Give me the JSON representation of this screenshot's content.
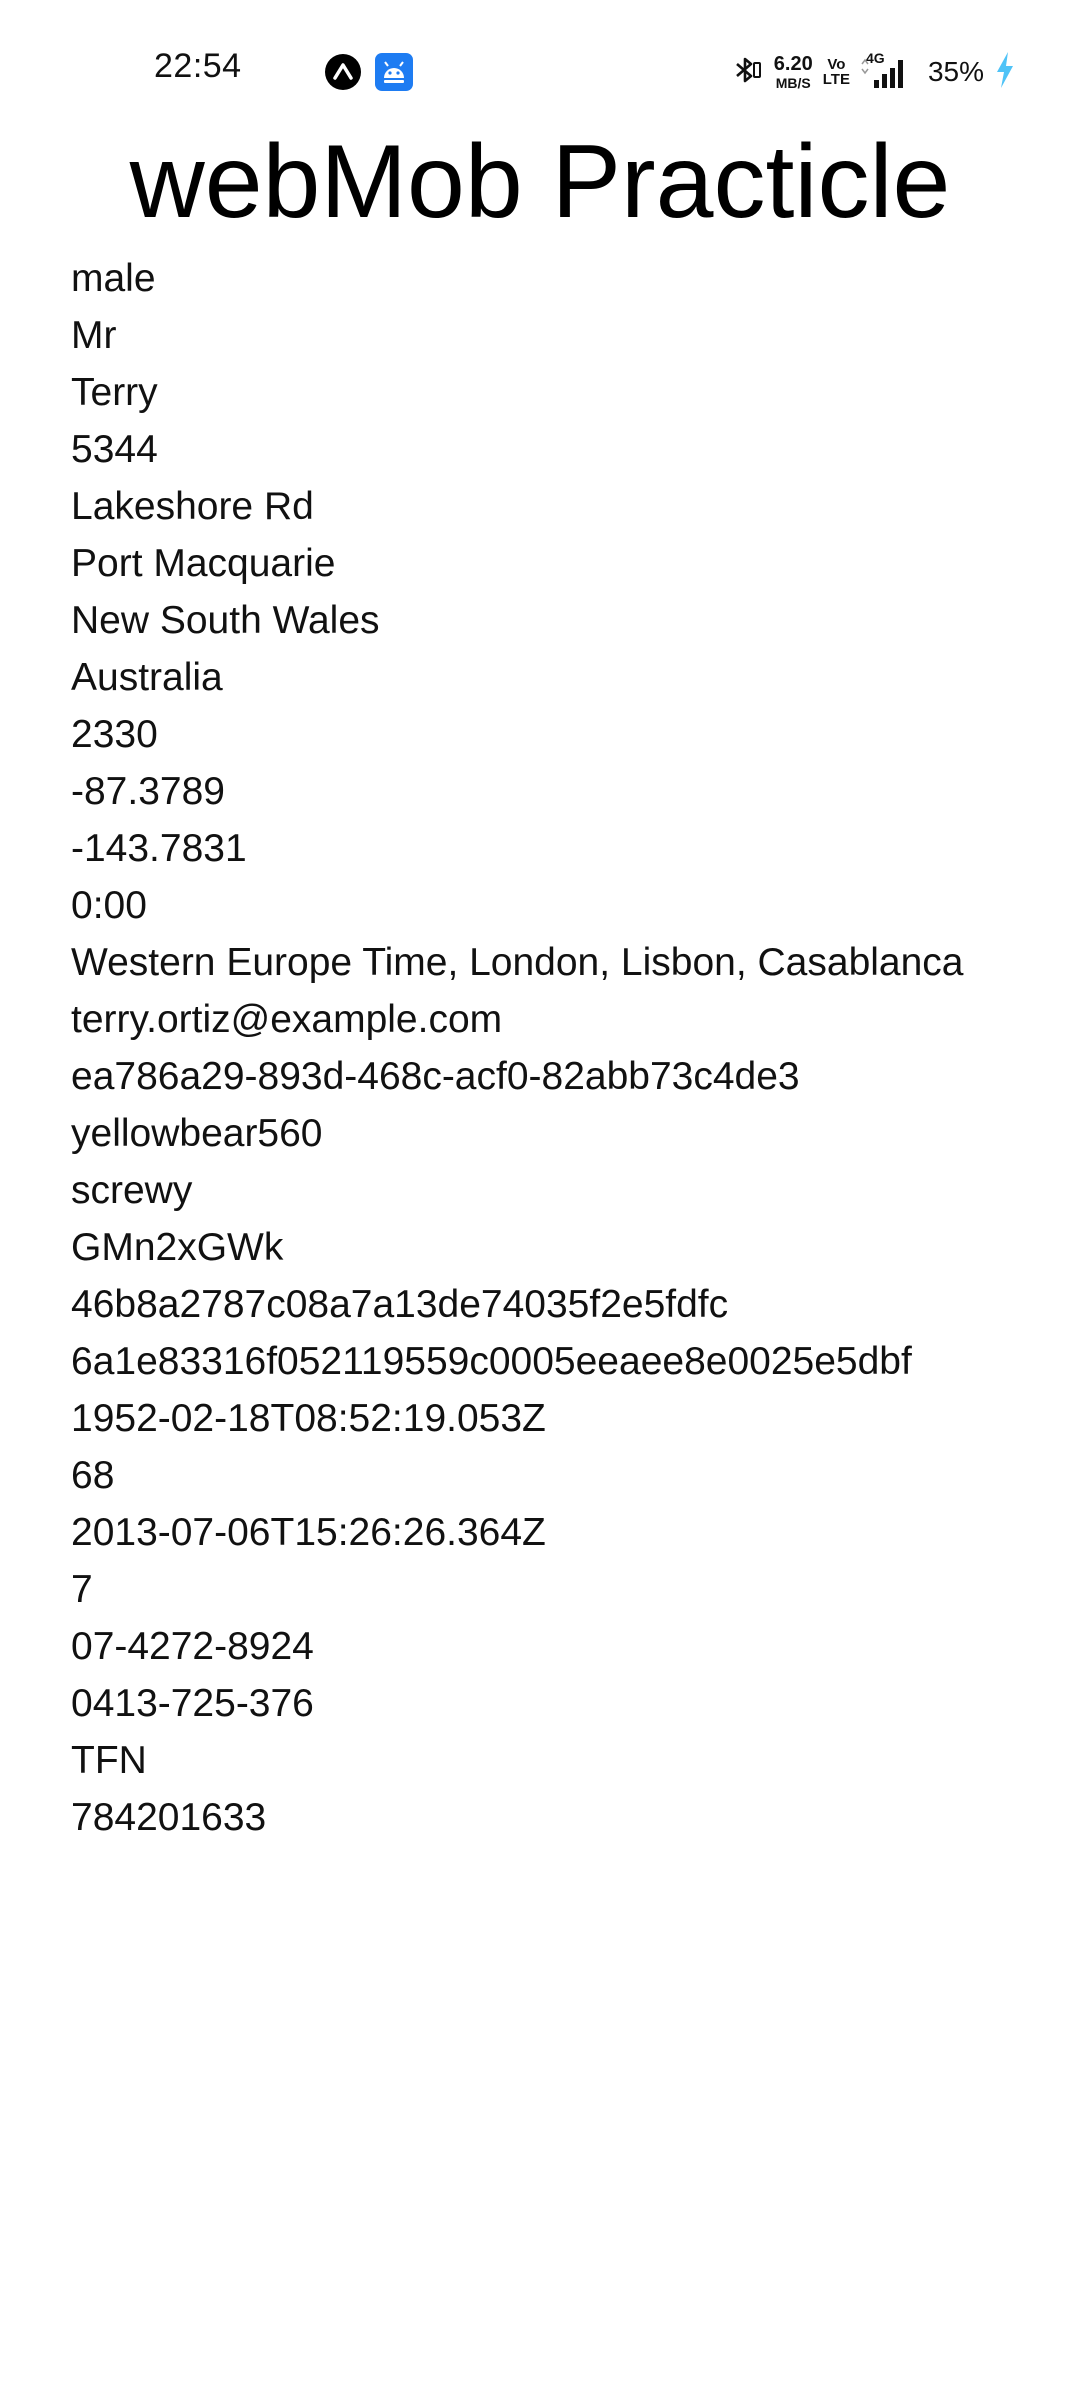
{
  "status_bar": {
    "time": "22:54",
    "notifications": [
      "expo-icon",
      "android-debug-icon"
    ],
    "net_speed_value": "6.20",
    "net_speed_unit": "MB/S",
    "volte_top": "Vo",
    "volte_bottom": "LTE",
    "network_type": "4G",
    "battery_percent": "35%",
    "charging_color": "#4fc3f7"
  },
  "header": {
    "title": "webMob Practicle"
  },
  "user_fields": [
    "male",
    "Mr",
    "Terry",
    "5344",
    "Lakeshore Rd",
    "Port Macquarie",
    "New South Wales",
    "Australia",
    "2330",
    "-87.3789",
    "-143.7831",
    "0:00",
    "Western Europe Time, London, Lisbon, Casablanca",
    "terry.ortiz@example.com",
    "ea786a29-893d-468c-acf0-82abb73c4de3",
    "yellowbear560",
    "screwy",
    "GMn2xGWk",
    "46b8a2787c08a7a13de74035f2e5fdfc",
    "6a1e83316f052119559c0005eeaee8e0025e5dbf",
    "1952-02-18T08:52:19.053Z",
    "68",
    "2013-07-06T15:26:26.364Z",
    "7",
    "07-4272-8924",
    "0413-725-376",
    "TFN",
    "784201633"
  ]
}
